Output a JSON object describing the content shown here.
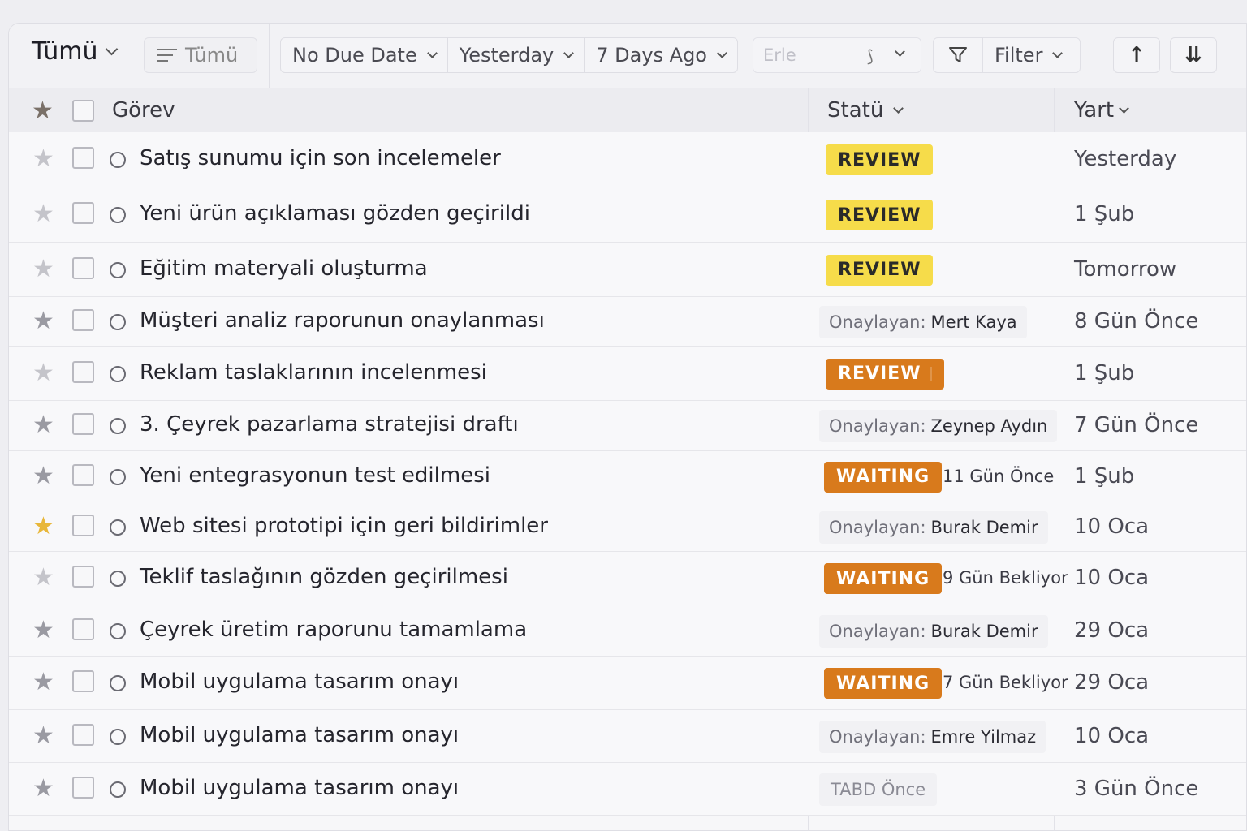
{
  "toolbar": {
    "title": "Tümü",
    "group_label": "Tümü",
    "date_filters": [
      "No Due Date",
      "Yesterday",
      "7 Days Ago"
    ],
    "search_placeholder": "Erle",
    "filter_label": "Filter"
  },
  "table": {
    "headers": {
      "task": "Görev",
      "status": "Statü",
      "due": "Yart"
    },
    "rows": [
      {
        "task": "Satış sunumu için son incelemeler",
        "starred": false,
        "status_type": "badge",
        "badge": "REVIEW",
        "badge_color": "#f6dc4a",
        "due": "Yesterday"
      },
      {
        "task": "Yeni ürün açıklaması gözden geçirildi",
        "starred": false,
        "status_type": "badge",
        "badge": "REVIEW",
        "badge_color": "#f6dc4a",
        "due": "1 Şub"
      },
      {
        "task": "Eğitim materyali oluşturma",
        "starred": false,
        "status_type": "badge",
        "badge": "REVIEW",
        "badge_color": "#f6dc4a",
        "due": "Tomorrow"
      },
      {
        "task": "Müşteri analiz raporunun onaylanması",
        "starred": false,
        "status_type": "approver",
        "approver_prefix": "Onaylayan:",
        "approver_name": "Mert Kaya",
        "due": "8 Gün Önce"
      },
      {
        "task": "Reklam taslaklarının incelenmesi",
        "starred": false,
        "status_type": "badge",
        "badge": "REVIEW",
        "badge_color": "#d87a1c",
        "due": "1 Şub"
      },
      {
        "task": "3. Çeyrek pazarlama stratejisi draftı",
        "starred": false,
        "status_type": "approver",
        "approver_prefix": "Onaylayan:",
        "approver_name": "Zeynep Aydın",
        "due": "7 Gün Önce"
      },
      {
        "task": "Yeni entegrasyonun test edilmesi",
        "starred": false,
        "status_type": "waiting",
        "badge": "WAITING",
        "badge_color": "#d87a1c",
        "note": "11 Gün Önce",
        "due": "1 Şub"
      },
      {
        "task": "Web sitesi prototipi için geri bildirimler",
        "starred": true,
        "status_type": "approver",
        "approver_prefix": "Onaylayan:",
        "approver_name": "Burak Demir",
        "due": "10 Oca"
      },
      {
        "task": "Teklif taslağının gözden geçirilmesi",
        "starred": false,
        "status_type": "waiting",
        "badge": "WAITING",
        "badge_color": "#d87a1c",
        "note": "9 Gün Bekliyor",
        "due": "10 Oca"
      },
      {
        "task": "Çeyrek üretim raporunu tamamlama",
        "starred": false,
        "status_type": "approver",
        "approver_prefix": "Onaylayan:",
        "approver_name": "Burak Demir",
        "due": "29 Oca"
      },
      {
        "task": "Mobil uygulama tasarım onayı",
        "starred": false,
        "status_type": "waiting",
        "badge": "WAITING",
        "badge_color": "#d87a1c",
        "note": "7 Gün Bekliyor",
        "due": "29 Oca"
      },
      {
        "task": "Mobil uygulama tasarım onayı",
        "starred": false,
        "status_type": "approver",
        "approver_prefix": "Onaylayan:",
        "approver_name": "Emre Yilmaz",
        "due": "10 Oca"
      },
      {
        "task": "Mobil uygulama tasarım onayı",
        "starred": false,
        "status_type": "plain",
        "note": "TABD Önce",
        "due": "3 Gün Önce"
      }
    ]
  }
}
